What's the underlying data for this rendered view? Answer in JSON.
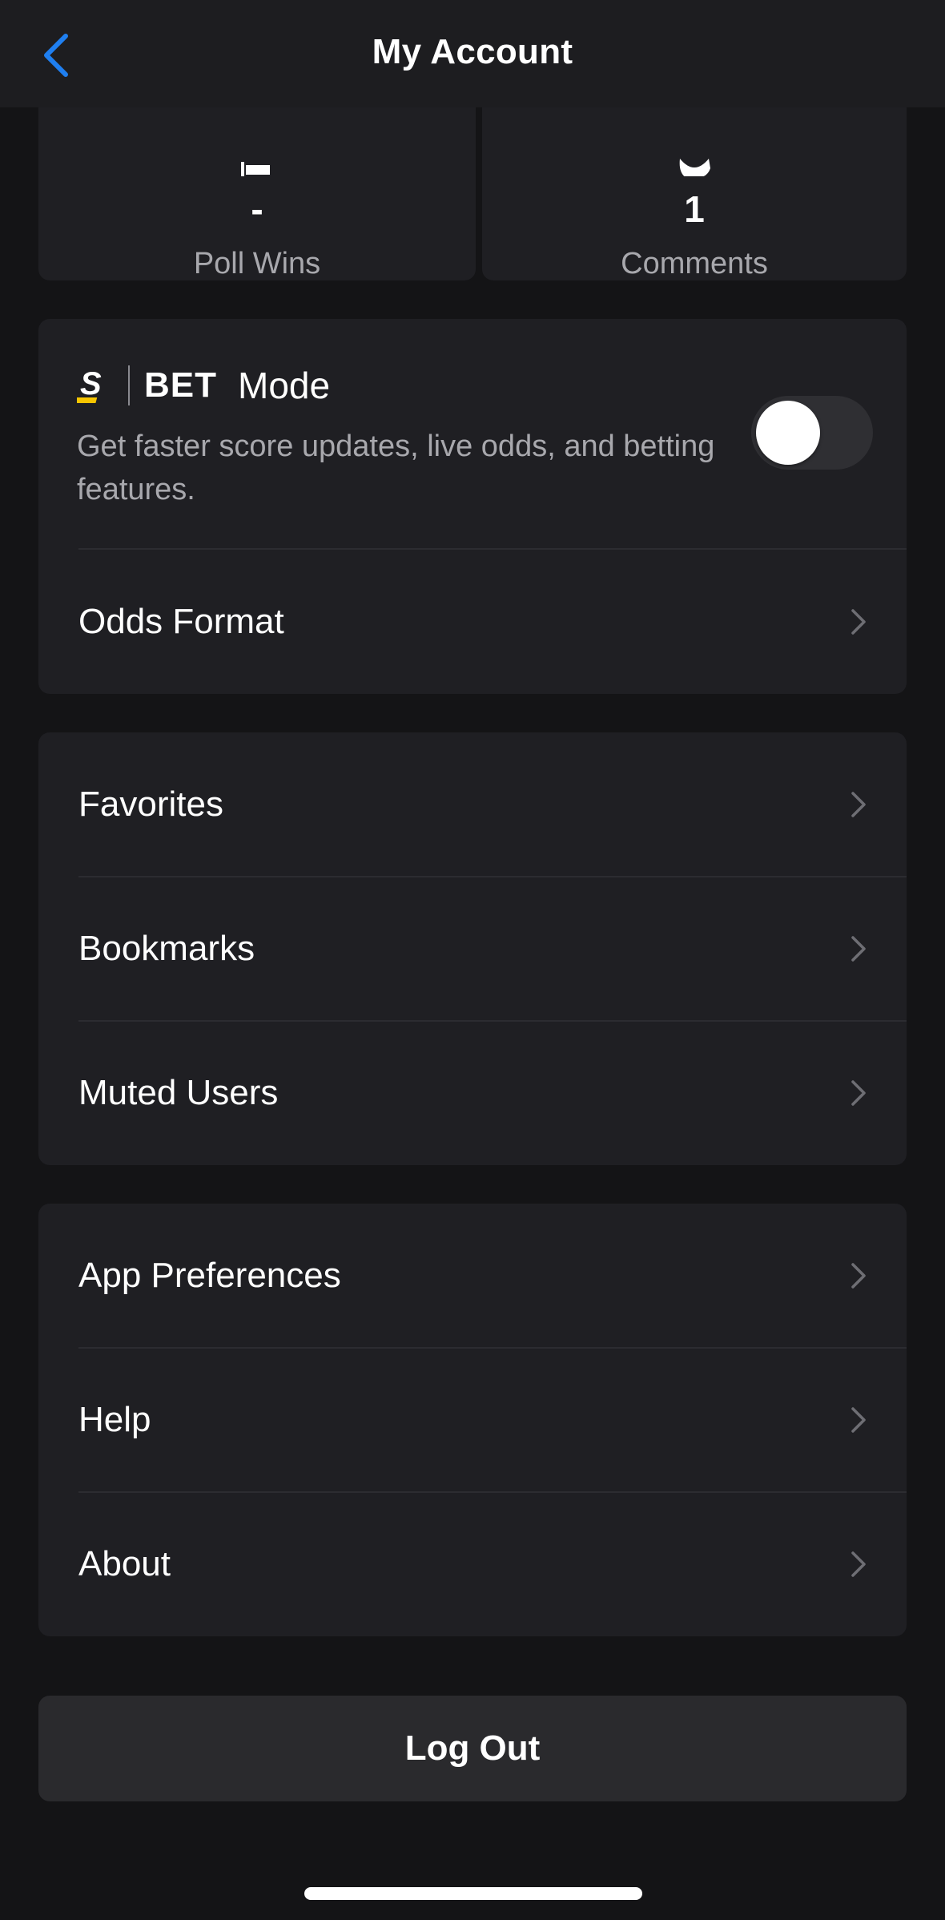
{
  "header": {
    "title": "My Account",
    "back_icon": "chevron-left-icon",
    "accent_color": "#1f7ff0"
  },
  "stats": [
    {
      "value": "-",
      "label": "Poll Wins",
      "icon": "poll-icon"
    },
    {
      "value": "1",
      "label": "Comments",
      "icon": "comment-icon"
    }
  ],
  "bet_mode": {
    "brand_word": "BET",
    "mode_label": "Mode",
    "description": "Get faster score updates, live odds, and betting features.",
    "enabled": false,
    "logo_color": "#f7c500"
  },
  "odds_format": {
    "label": "Odds Format"
  },
  "group_personal": [
    {
      "label": "Favorites"
    },
    {
      "label": "Bookmarks"
    },
    {
      "label": "Muted Users"
    }
  ],
  "group_app": [
    {
      "label": "App Preferences"
    },
    {
      "label": "Help"
    },
    {
      "label": "About"
    }
  ],
  "logout": {
    "label": "Log Out"
  }
}
